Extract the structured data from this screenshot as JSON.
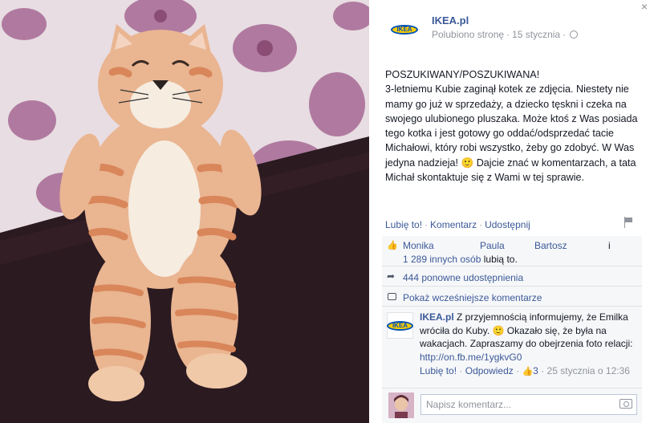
{
  "window": {
    "close_glyph": "×"
  },
  "header": {
    "page_name": "IKEA.pl",
    "logo_text": "IKEA",
    "liked": "Polubiono stronę",
    "dot": "·",
    "date": "15 stycznia",
    "dot2": "·"
  },
  "post": {
    "text": "POSZUKIWANY/POSZUKIWANA!\n3-letniemu Kubie zaginął kotek ze zdjęcia. Niestety nie mamy go już w sprzedaży, a dziecko tęskni i czeka na swojego ulubionego pluszaka. Może ktoś z Was posiada tego kotka i jest gotowy go oddać/odsprzedać tacie Michałowi, który robi wszystko, żeby go zdobyć. W Was jedyna nadzieja! 🙂 Dajcie znać w komentarzach, a tata Michał skontaktuje się z Wami w tej sprawie."
  },
  "actions": {
    "like": "Lubię to!",
    "comment": "Komentarz",
    "share": "Udostępnij",
    "sep": "·"
  },
  "likes": {
    "names": [
      "Monika",
      "Paula",
      "Bartosz"
    ],
    "and": "i",
    "others": "1 289 innych osób",
    "suffix": "lubią to."
  },
  "shares": {
    "label": "444 ponowne udostępnienia"
  },
  "previous": {
    "label": "Pokaż wcześniejsze komentarze"
  },
  "comment": {
    "author": "IKEA.pl",
    "logo_text": "IKEA",
    "text": "Z przyjemnością informujemy, że Emilka wróciła do Kuby. 🙂 Okazało się, że była na wakacjach. Zapraszamy do obejrzenia foto relacji:",
    "link": "http://on.fb.me/1ygkvG0",
    "like": "Lubię to!",
    "reply": "Odpowiedz",
    "likes": "3",
    "time": "25 stycznia o 12:36",
    "sep": "·"
  },
  "compose": {
    "placeholder": "Napisz komentarz..."
  },
  "colors": {
    "link": "#3b5998",
    "panel": "#f6f7f9",
    "ikea_yellow": "#ffcc00",
    "ikea_blue": "#0051ba"
  }
}
